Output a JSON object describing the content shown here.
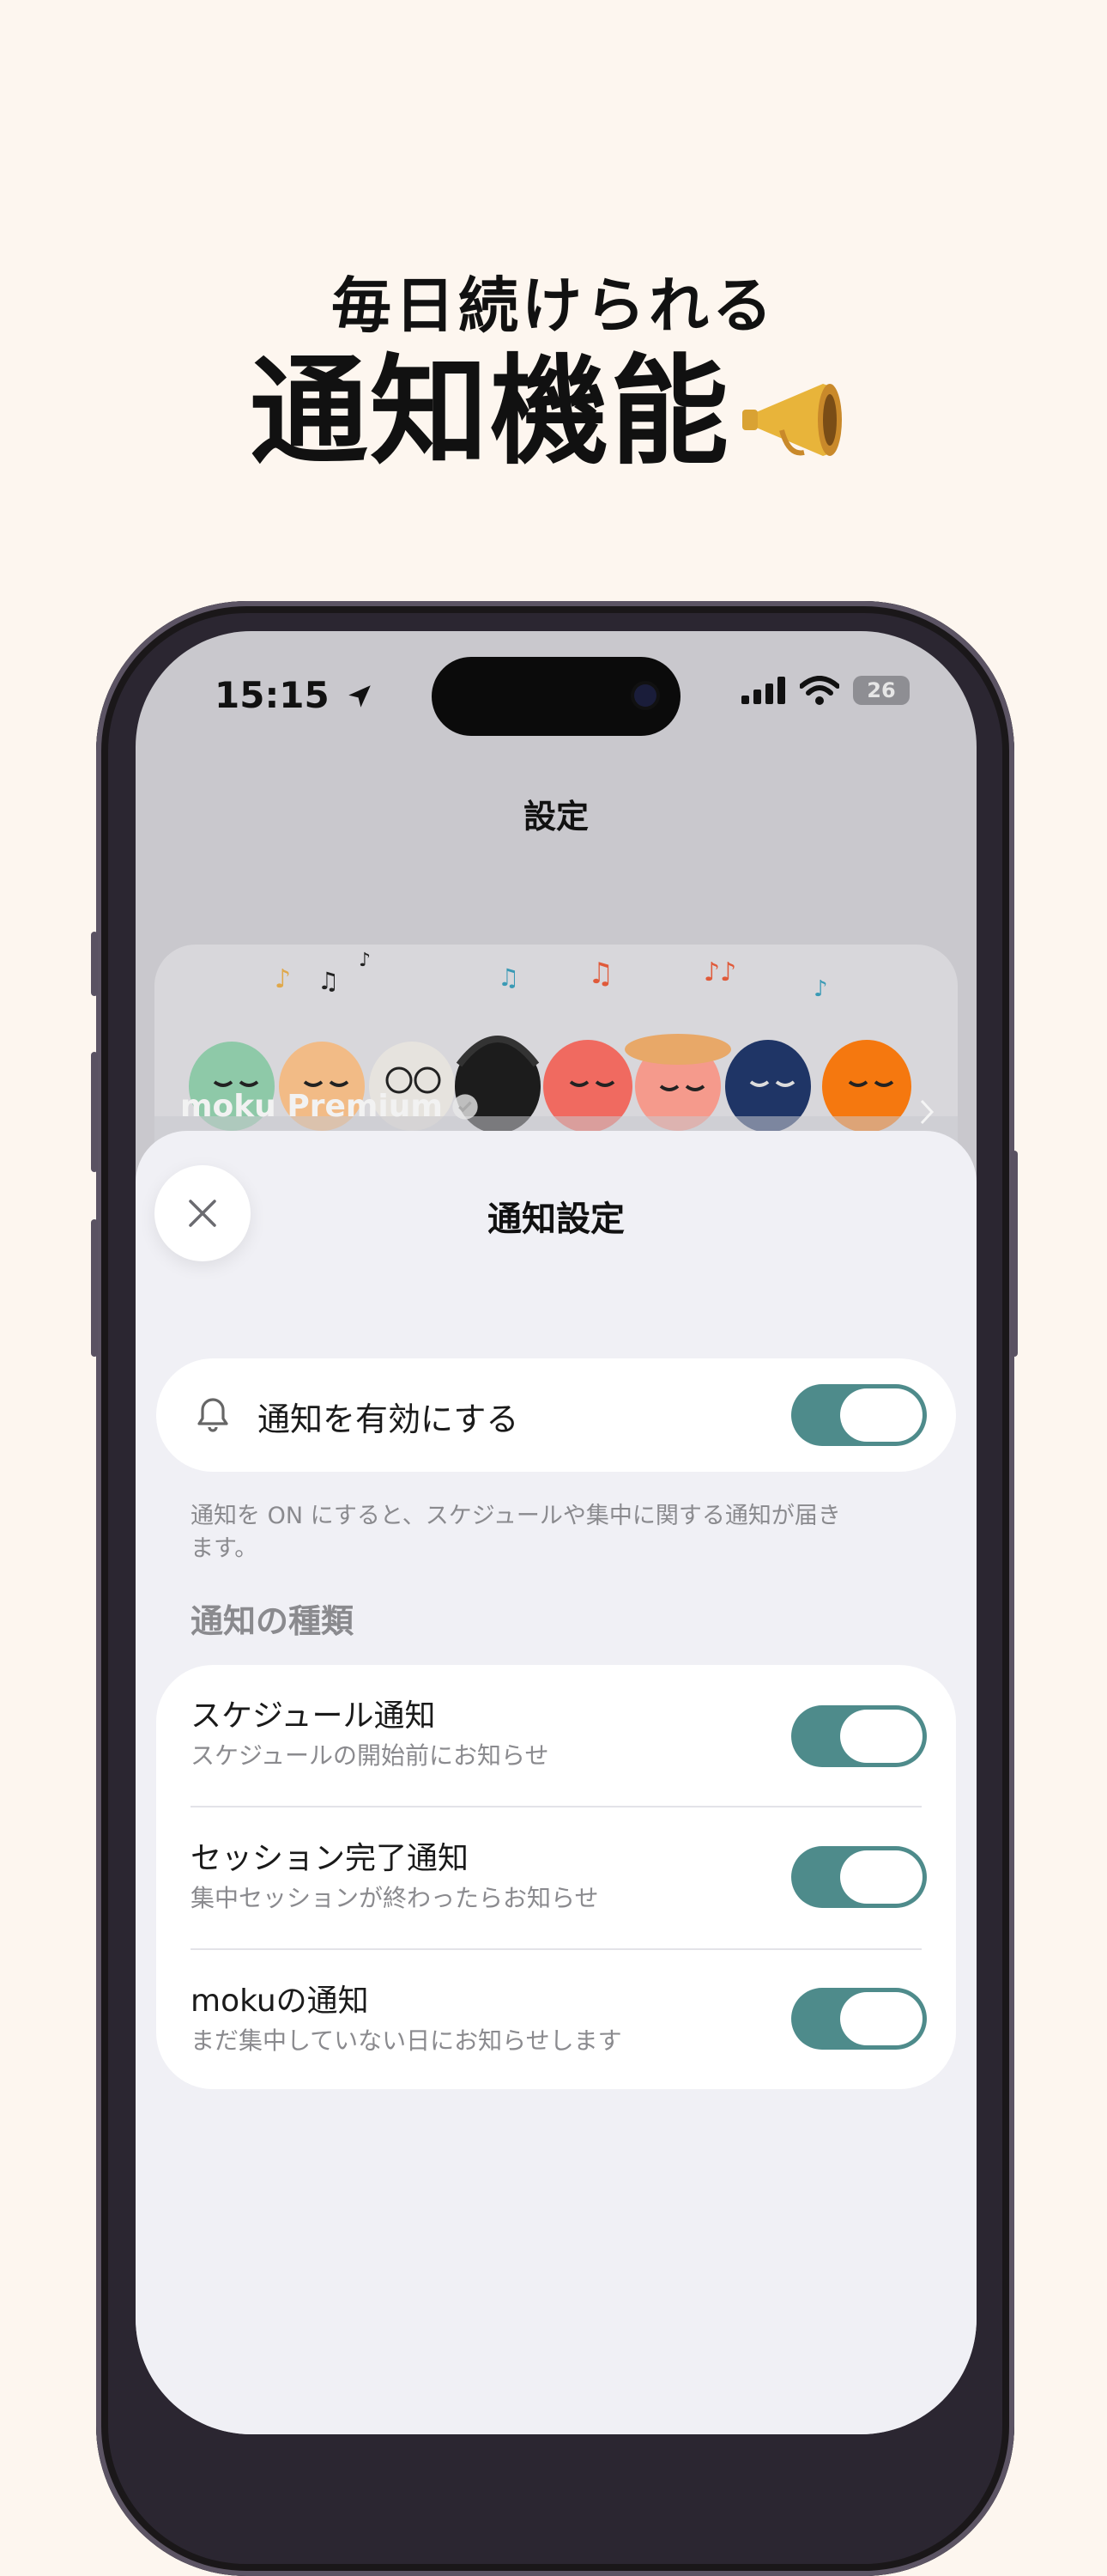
{
  "promo": {
    "subtitle": "毎日続けられる",
    "title": "通知機能"
  },
  "status_bar": {
    "time": "15:15",
    "battery": "26"
  },
  "nav": {
    "title": "設定"
  },
  "premium_banner": {
    "label": "moku Premium"
  },
  "sheet": {
    "title": "通知設定",
    "master_toggle": {
      "label": "通知を有効にする",
      "on": true
    },
    "note": "通知を ON にすると、スケジュールや集中に関する通知が届きます。",
    "section_title": "通知の種類",
    "items": [
      {
        "title": "スケジュール通知",
        "subtitle": "スケジュールの開始前にお知らせ",
        "on": true
      },
      {
        "title": "セッション完了通知",
        "subtitle": "集中セッションが終わったらお知らせ",
        "on": true
      },
      {
        "title": "mokuの通知",
        "subtitle": "まだ集中していない日にお知らせします",
        "on": true
      }
    ]
  },
  "colors": {
    "background": "#fdf6ef",
    "toggle_on": "#4e8b8b",
    "sheet_bg": "#f0f0f5"
  },
  "icons": [
    "megaphone-icon",
    "location-arrow-icon",
    "signal-icon",
    "wifi-icon",
    "battery-icon",
    "verified-icon",
    "chevron-right-icon",
    "close-icon",
    "bell-icon"
  ]
}
